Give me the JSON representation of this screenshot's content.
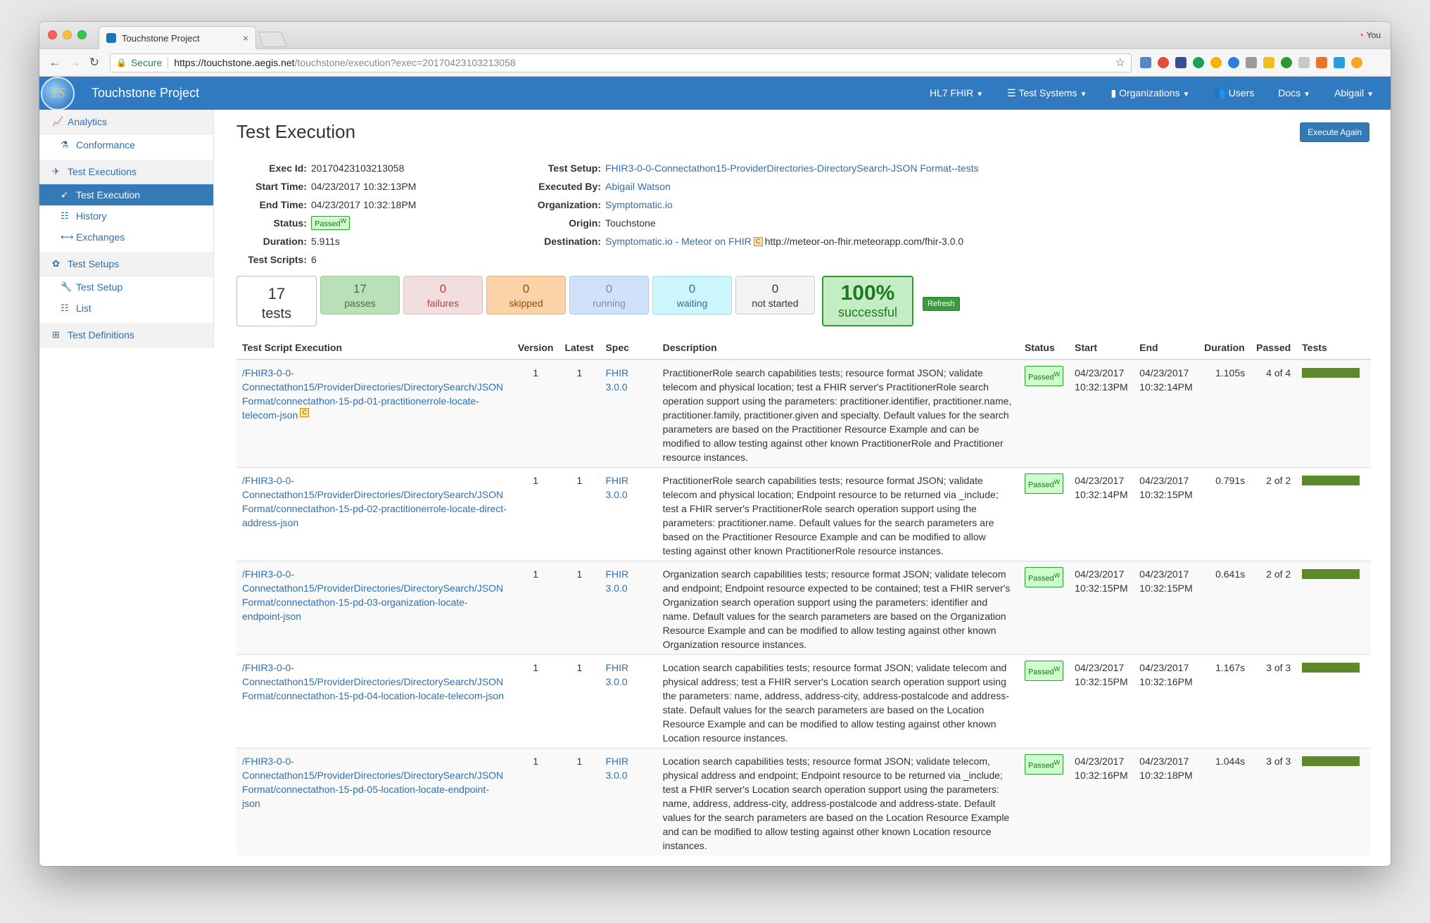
{
  "browser": {
    "tab_title": "Touchstone Project",
    "tab_close": "×",
    "profile": "You",
    "secure_label": "Secure",
    "url_host": "https://touchstone.aegis.net",
    "url_path": "/touchstone/execution?exec=20170423103213058"
  },
  "appnav": {
    "logo_text": "TS",
    "brand": "Touchstone Project",
    "menu": [
      "HL7 FHIR",
      "Test Systems",
      "Organizations",
      "Users",
      "Docs",
      "Abigail"
    ]
  },
  "sidebar": {
    "analytics": "Analytics",
    "conformance": "Conformance",
    "test_executions": "Test Executions",
    "test_execution": "Test Execution",
    "history": "History",
    "exchanges": "Exchanges",
    "test_setups": "Test Setups",
    "test_setup": "Test Setup",
    "list": "List",
    "test_definitions": "Test Definitions"
  },
  "page": {
    "title": "Test Execution",
    "execute_again": "Execute Again"
  },
  "info": {
    "exec_id_label": "Exec Id:",
    "exec_id": "20170423103213058",
    "start_label": "Start Time:",
    "start": "04/23/2017 10:32:13PM",
    "end_label": "End Time:",
    "end": "04/23/2017 10:32:18PM",
    "status_label": "Status:",
    "status": "Passed",
    "status_sup": "W",
    "duration_label": "Duration:",
    "duration": "5.911s",
    "scripts_label": "Test Scripts:",
    "scripts": "6",
    "setup_label": "Test Setup:",
    "setup": "FHIR3-0-0-Connectathon15-ProviderDirectories-DirectorySearch-JSON Format--tests",
    "executed_by_label": "Executed By:",
    "executed_by": "Abigail Watson",
    "org_label": "Organization:",
    "org": "Symptomatic.io",
    "origin_label": "Origin:",
    "origin": "Touchstone",
    "dest_label": "Destination:",
    "dest": "Symptomatic.io - Meteor on FHIR",
    "dest_badge": "C",
    "dest_url": "http://meteor-on-fhir.meteorapp.com/fhir-3.0.0"
  },
  "stats": {
    "total": "17",
    "total_label": "tests",
    "passes": "17",
    "passes_label": "passes",
    "failures": "0",
    "failures_label": "failures",
    "skipped": "0",
    "skipped_label": "skipped",
    "running": "0",
    "running_label": "running",
    "waiting": "0",
    "waiting_label": "waiting",
    "not_started": "0",
    "not_started_label": "not started",
    "success_pct": "100%",
    "success_label": "successful",
    "refresh": "Refresh"
  },
  "table": {
    "headers": [
      "Test Script Execution",
      "Version",
      "Latest",
      "Spec",
      "Description",
      "Status",
      "Start",
      "End",
      "Duration",
      "Passed",
      "Tests"
    ],
    "rows": [
      {
        "script": "/FHIR3-0-0-Connectathon15/ProviderDirectories/DirectorySearch/JSON Format/connectathon-15-pd-01-practitionerrole-locate-telecom-json",
        "badge": "C",
        "version": "1",
        "latest": "1",
        "spec": "FHIR 3.0.0",
        "desc": "PractitionerRole search capabilities tests; resource format JSON; validate telecom and physical location; test a FHIR server's PractitionerRole search operation support using the parameters: practitioner.identifier, practitioner.name, practitioner.family, practitioner.given and specialty. Default values for the search parameters are based on the Practitioner Resource Example and can be modified to allow testing against other known PractitionerRole and Practitioner resource instances.",
        "status": "Passed",
        "status_sup": "W",
        "start": "04/23/2017 10:32:13PM",
        "end": "04/23/2017 10:32:14PM",
        "duration": "1.105s",
        "passed": "4 of 4",
        "progress": 1.0
      },
      {
        "script": "/FHIR3-0-0-Connectathon15/ProviderDirectories/DirectorySearch/JSON Format/connectathon-15-pd-02-practitionerrole-locate-direct-address-json",
        "badge": "",
        "version": "1",
        "latest": "1",
        "spec": "FHIR 3.0.0",
        "desc": "PractitionerRole search capabilities tests; resource format JSON; validate telecom and physical location; Endpoint resource to be returned via _include; test a FHIR server's PractitionerRole search operation support using the parameters: practitioner.name. Default values for the search parameters are based on the Practitioner Resource Example and can be modified to allow testing against other known PractitionerRole resource instances.",
        "status": "Passed",
        "status_sup": "W",
        "start": "04/23/2017 10:32:14PM",
        "end": "04/23/2017 10:32:15PM",
        "duration": "0.791s",
        "passed": "2 of 2",
        "progress": 1.0
      },
      {
        "script": "/FHIR3-0-0-Connectathon15/ProviderDirectories/DirectorySearch/JSON Format/connectathon-15-pd-03-organization-locate-endpoint-json",
        "badge": "",
        "version": "1",
        "latest": "1",
        "spec": "FHIR 3.0.0",
        "desc": "Organization search capabilities tests; resource format JSON; validate telecom and endpoint; Endpoint resource expected to be contained; test a FHIR server's Organization search operation support using the parameters: identifier and name. Default values for the search parameters are based on the Organization Resource Example and can be modified to allow testing against other known Organization resource instances.",
        "status": "Passed",
        "status_sup": "W",
        "start": "04/23/2017 10:32:15PM",
        "end": "04/23/2017 10:32:15PM",
        "duration": "0.641s",
        "passed": "2 of 2",
        "progress": 1.0
      },
      {
        "script": "/FHIR3-0-0-Connectathon15/ProviderDirectories/DirectorySearch/JSON Format/connectathon-15-pd-04-location-locate-telecom-json",
        "badge": "",
        "version": "1",
        "latest": "1",
        "spec": "FHIR 3.0.0",
        "desc": "Location search capabilities tests; resource format JSON; validate telecom and physical address; test a FHIR server's Location search operation support using the parameters: name, address, address-city, address-postalcode and address-state. Default values for the search parameters are based on the Location Resource Example and can be modified to allow testing against other known Location resource instances.",
        "status": "Passed",
        "status_sup": "W",
        "start": "04/23/2017 10:32:15PM",
        "end": "04/23/2017 10:32:16PM",
        "duration": "1.167s",
        "passed": "3 of 3",
        "progress": 1.0
      },
      {
        "script": "/FHIR3-0-0-Connectathon15/ProviderDirectories/DirectorySearch/JSON Format/connectathon-15-pd-05-location-locate-endpoint-json",
        "badge": "",
        "version": "1",
        "latest": "1",
        "spec": "FHIR 3.0.0",
        "desc": "Location search capabilities tests; resource format JSON; validate telecom, physical address and endpoint; Endpoint resource to be returned via _include; test a FHIR server's Location search operation support using the parameters: name, address, address-city, address-postalcode and address-state. Default values for the search parameters are based on the Location Resource Example and can be modified to allow testing against other known Location resource instances.",
        "status": "Passed",
        "status_sup": "W",
        "start": "04/23/2017 10:32:16PM",
        "end": "04/23/2017 10:32:18PM",
        "duration": "1.044s",
        "passed": "3 of 3",
        "progress": 1.0
      }
    ]
  },
  "colors": {
    "accent": "#337ab7",
    "navbar": "#2f7ac0",
    "bar": "#5c8a2a",
    "success": "#2e9a2e"
  }
}
